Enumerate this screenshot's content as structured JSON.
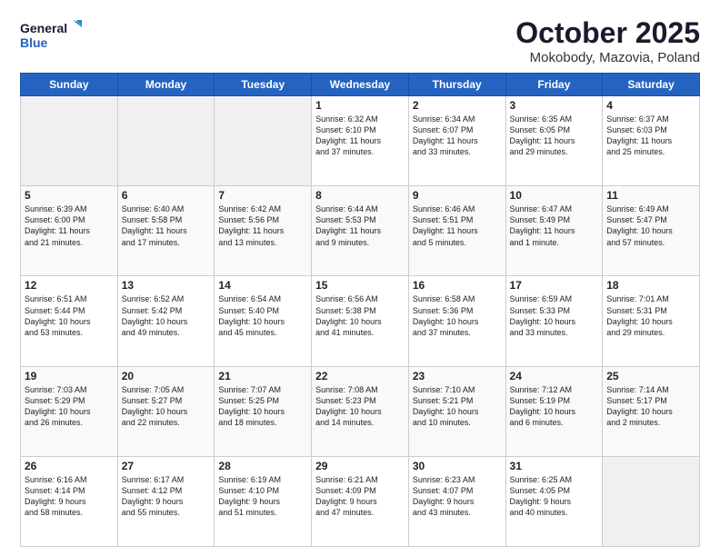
{
  "logo": {
    "line1": "General",
    "line2": "Blue"
  },
  "title": "October 2025",
  "subtitle": "Mokobody, Mazovia, Poland",
  "days_of_week": [
    "Sunday",
    "Monday",
    "Tuesday",
    "Wednesday",
    "Thursday",
    "Friday",
    "Saturday"
  ],
  "weeks": [
    [
      {
        "day": null,
        "empty": true
      },
      {
        "day": null,
        "empty": true
      },
      {
        "day": null,
        "empty": true
      },
      {
        "day": "1",
        "lines": [
          "Sunrise: 6:32 AM",
          "Sunset: 6:10 PM",
          "Daylight: 11 hours",
          "and 37 minutes."
        ]
      },
      {
        "day": "2",
        "lines": [
          "Sunrise: 6:34 AM",
          "Sunset: 6:07 PM",
          "Daylight: 11 hours",
          "and 33 minutes."
        ]
      },
      {
        "day": "3",
        "lines": [
          "Sunrise: 6:35 AM",
          "Sunset: 6:05 PM",
          "Daylight: 11 hours",
          "and 29 minutes."
        ]
      },
      {
        "day": "4",
        "lines": [
          "Sunrise: 6:37 AM",
          "Sunset: 6:03 PM",
          "Daylight: 11 hours",
          "and 25 minutes."
        ]
      }
    ],
    [
      {
        "day": "5",
        "lines": [
          "Sunrise: 6:39 AM",
          "Sunset: 6:00 PM",
          "Daylight: 11 hours",
          "and 21 minutes."
        ]
      },
      {
        "day": "6",
        "lines": [
          "Sunrise: 6:40 AM",
          "Sunset: 5:58 PM",
          "Daylight: 11 hours",
          "and 17 minutes."
        ]
      },
      {
        "day": "7",
        "lines": [
          "Sunrise: 6:42 AM",
          "Sunset: 5:56 PM",
          "Daylight: 11 hours",
          "and 13 minutes."
        ]
      },
      {
        "day": "8",
        "lines": [
          "Sunrise: 6:44 AM",
          "Sunset: 5:53 PM",
          "Daylight: 11 hours",
          "and 9 minutes."
        ]
      },
      {
        "day": "9",
        "lines": [
          "Sunrise: 6:46 AM",
          "Sunset: 5:51 PM",
          "Daylight: 11 hours",
          "and 5 minutes."
        ]
      },
      {
        "day": "10",
        "lines": [
          "Sunrise: 6:47 AM",
          "Sunset: 5:49 PM",
          "Daylight: 11 hours",
          "and 1 minute."
        ]
      },
      {
        "day": "11",
        "lines": [
          "Sunrise: 6:49 AM",
          "Sunset: 5:47 PM",
          "Daylight: 10 hours",
          "and 57 minutes."
        ]
      }
    ],
    [
      {
        "day": "12",
        "lines": [
          "Sunrise: 6:51 AM",
          "Sunset: 5:44 PM",
          "Daylight: 10 hours",
          "and 53 minutes."
        ]
      },
      {
        "day": "13",
        "lines": [
          "Sunrise: 6:52 AM",
          "Sunset: 5:42 PM",
          "Daylight: 10 hours",
          "and 49 minutes."
        ]
      },
      {
        "day": "14",
        "lines": [
          "Sunrise: 6:54 AM",
          "Sunset: 5:40 PM",
          "Daylight: 10 hours",
          "and 45 minutes."
        ]
      },
      {
        "day": "15",
        "lines": [
          "Sunrise: 6:56 AM",
          "Sunset: 5:38 PM",
          "Daylight: 10 hours",
          "and 41 minutes."
        ]
      },
      {
        "day": "16",
        "lines": [
          "Sunrise: 6:58 AM",
          "Sunset: 5:36 PM",
          "Daylight: 10 hours",
          "and 37 minutes."
        ]
      },
      {
        "day": "17",
        "lines": [
          "Sunrise: 6:59 AM",
          "Sunset: 5:33 PM",
          "Daylight: 10 hours",
          "and 33 minutes."
        ]
      },
      {
        "day": "18",
        "lines": [
          "Sunrise: 7:01 AM",
          "Sunset: 5:31 PM",
          "Daylight: 10 hours",
          "and 29 minutes."
        ]
      }
    ],
    [
      {
        "day": "19",
        "lines": [
          "Sunrise: 7:03 AM",
          "Sunset: 5:29 PM",
          "Daylight: 10 hours",
          "and 26 minutes."
        ]
      },
      {
        "day": "20",
        "lines": [
          "Sunrise: 7:05 AM",
          "Sunset: 5:27 PM",
          "Daylight: 10 hours",
          "and 22 minutes."
        ]
      },
      {
        "day": "21",
        "lines": [
          "Sunrise: 7:07 AM",
          "Sunset: 5:25 PM",
          "Daylight: 10 hours",
          "and 18 minutes."
        ]
      },
      {
        "day": "22",
        "lines": [
          "Sunrise: 7:08 AM",
          "Sunset: 5:23 PM",
          "Daylight: 10 hours",
          "and 14 minutes."
        ]
      },
      {
        "day": "23",
        "lines": [
          "Sunrise: 7:10 AM",
          "Sunset: 5:21 PM",
          "Daylight: 10 hours",
          "and 10 minutes."
        ]
      },
      {
        "day": "24",
        "lines": [
          "Sunrise: 7:12 AM",
          "Sunset: 5:19 PM",
          "Daylight: 10 hours",
          "and 6 minutes."
        ]
      },
      {
        "day": "25",
        "lines": [
          "Sunrise: 7:14 AM",
          "Sunset: 5:17 PM",
          "Daylight: 10 hours",
          "and 2 minutes."
        ]
      }
    ],
    [
      {
        "day": "26",
        "lines": [
          "Sunrise: 6:16 AM",
          "Sunset: 4:14 PM",
          "Daylight: 9 hours",
          "and 58 minutes."
        ]
      },
      {
        "day": "27",
        "lines": [
          "Sunrise: 6:17 AM",
          "Sunset: 4:12 PM",
          "Daylight: 9 hours",
          "and 55 minutes."
        ]
      },
      {
        "day": "28",
        "lines": [
          "Sunrise: 6:19 AM",
          "Sunset: 4:10 PM",
          "Daylight: 9 hours",
          "and 51 minutes."
        ]
      },
      {
        "day": "29",
        "lines": [
          "Sunrise: 6:21 AM",
          "Sunset: 4:09 PM",
          "Daylight: 9 hours",
          "and 47 minutes."
        ]
      },
      {
        "day": "30",
        "lines": [
          "Sunrise: 6:23 AM",
          "Sunset: 4:07 PM",
          "Daylight: 9 hours",
          "and 43 minutes."
        ]
      },
      {
        "day": "31",
        "lines": [
          "Sunrise: 6:25 AM",
          "Sunset: 4:05 PM",
          "Daylight: 9 hours",
          "and 40 minutes."
        ]
      },
      {
        "day": null,
        "empty": true
      }
    ]
  ]
}
